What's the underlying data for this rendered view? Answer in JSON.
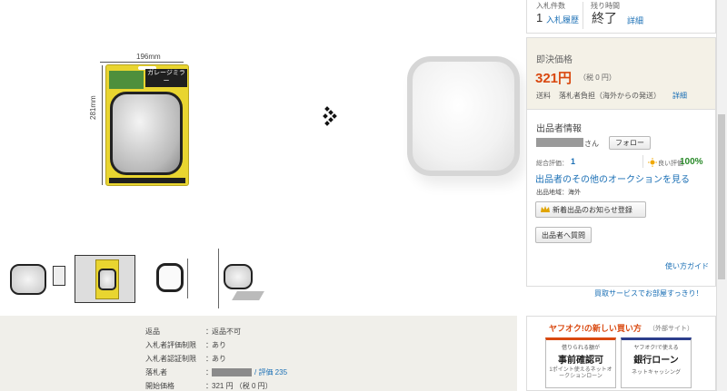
{
  "bid_info": {
    "bids_label": "入札件数",
    "bids_value": "1",
    "bid_history_link": "入札履歴",
    "time_left_label": "残り時間",
    "time_left_value": "終了",
    "time_detail_link": "詳細"
  },
  "price": {
    "label": "即決価格",
    "amount": "321円",
    "tax": "（税 0 円）",
    "shipping_label": "送料",
    "shipping_value": "落札者負担（海外からの発送）",
    "shipping_detail_link": "詳細"
  },
  "seller": {
    "section_title": "出品者情報",
    "name_suffix": "さん",
    "follow_button": "フォロー",
    "rating_label": "総合評価：",
    "rating_value": "1",
    "good_rating_label": "良い評価",
    "good_rating_value": "100%",
    "other_auctions_link": "出品者のその他のオークションを見る",
    "region_label": "出品地域：海外",
    "new_listing_button": "新着出品のお知らせ登録",
    "question_button": "出品者へ質問",
    "guide_link": "使い方ガイド"
  },
  "promo": {
    "line": "買取サービスでお部屋すっきり！",
    "title": "ヤフオク!の新しい買い方",
    "title_note": "（外部サイト）",
    "card1_top": "借りられる額が",
    "card1_main": "事前確認可",
    "card1_sub": "1ポイント使えるネットオークションローン",
    "card2_top": "ヤフオク!で使える",
    "card2_main": "銀行ローン",
    "card2_sub": "ネットキャッシング"
  },
  "product_image": {
    "width_label": "196mm",
    "height_label": "281mm",
    "package_title": "ガレージミラー"
  },
  "details": [
    {
      "label": "返品",
      "value": "返品不可",
      "label_link": false
    },
    {
      "label": "入札者評価制限",
      "value": "あり",
      "label_link": true
    },
    {
      "label": "入札者認証制限",
      "value": "あり",
      "label_link": true
    },
    {
      "label": "落札者",
      "value": "/ 評価 235",
      "label_link": false
    },
    {
      "label": "開始価格",
      "value": "321 円 （税 0 円）",
      "label_link": false
    }
  ],
  "colors": {
    "price_red": "#d9480f",
    "link_blue": "#1a6fb5",
    "promo_red": "#d9480f",
    "good_green": "#2a8a2a"
  }
}
